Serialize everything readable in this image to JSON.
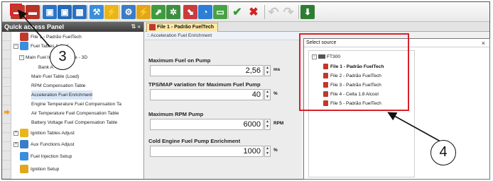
{
  "colors": {
    "accent_red": "#d8222a",
    "panel_header": "#4a4a4a",
    "tab_bg": "#ffe9a8"
  },
  "toolbar": {
    "buttons": [
      {
        "name": "file-open-red-icon",
        "color": "#c0392b",
        "glyph": "▬"
      },
      {
        "name": "file-compare-red-icon",
        "color": "#b83227",
        "glyph": "▬"
      },
      {
        "name": "blue-window-icon",
        "color": "#2b74c9",
        "glyph": "▣"
      },
      {
        "name": "blue-window-2-icon",
        "color": "#2369b8",
        "glyph": "▣"
      },
      {
        "name": "blue-tables-icon",
        "color": "#2c6fbf",
        "glyph": "▦"
      },
      {
        "name": "wrench-blue-icon",
        "color": "#3a8edc",
        "glyph": "⚒"
      },
      {
        "name": "yellow-bolt-icon",
        "color": "#e9b51b",
        "glyph": "⚡"
      },
      {
        "name": "aux-tool-icon",
        "color": "#3a7cc7",
        "glyph": "⚙"
      },
      {
        "name": "fuel-yellow-icon",
        "color": "#e2a61a",
        "glyph": "⚡"
      },
      {
        "name": "chart-green-icon",
        "color": "#3f9b3f",
        "glyph": "⬈"
      },
      {
        "name": "tools-green-icon",
        "color": "#3e8e41",
        "glyph": "✲"
      },
      {
        "name": "graph-red-icon",
        "color": "#cc3b3b",
        "glyph": "⬊"
      },
      {
        "name": "gauge-blue-icon",
        "color": "#2c7ed6",
        "glyph": "◔"
      },
      {
        "name": "monitor-green-icon",
        "color": "#48a148",
        "glyph": "▭"
      },
      {
        "name": "check-icon",
        "color": "#2f9e2f",
        "glyph": "✔"
      },
      {
        "name": "cross-icon",
        "color": "#d32222",
        "glyph": "✖"
      },
      {
        "name": "undo-icon",
        "color": "#c9c9c9",
        "glyph": "↶"
      },
      {
        "name": "redo-icon",
        "color": "#c9c9c9",
        "glyph": "↷"
      },
      {
        "name": "save-to-ecu-icon",
        "color": "#2e7d32",
        "glyph": "⬇"
      }
    ]
  },
  "quick_access": {
    "title": "Quick access Panel",
    "header_icons": "⇅ «",
    "items": [
      {
        "label": "File 1 - Padrão FuelTech",
        "indent": 0,
        "icon_color": "#c0392b",
        "expander": ""
      },
      {
        "label": "Fuel Tables Adjust",
        "indent": 0,
        "icon_color": "#3a8edc",
        "expander": "−"
      },
      {
        "label": "Main Fuel Injection Table - 3D",
        "indent": 1,
        "icon_color": "",
        "expander": "−"
      },
      {
        "label": "Bank A",
        "indent": 3,
        "icon_color": "",
        "expander": ""
      },
      {
        "label": "Main Fuel Table (Load)",
        "indent": 2,
        "icon_color": "",
        "expander": ""
      },
      {
        "label": "RPM Compensation Table",
        "indent": 2,
        "icon_color": "",
        "expander": ""
      },
      {
        "label": "Acceleration Fuel Enrichment",
        "indent": 2,
        "icon_color": "",
        "expander": "",
        "selected": true
      },
      {
        "label": "Engine Temperature Fuel Compensation Ta",
        "indent": 2,
        "icon_color": "",
        "expander": ""
      },
      {
        "label": "Air Temperature Fuel Compensation Table",
        "indent": 2,
        "icon_color": "",
        "expander": ""
      },
      {
        "label": "Battery Voltage Fuel Compensation Table",
        "indent": 2,
        "icon_color": "",
        "expander": ""
      },
      {
        "label": "Ignition Tables Adjust",
        "indent": 0,
        "icon_color": "#e9b51b",
        "expander": "+"
      },
      {
        "label": "Aux Functions Adjust",
        "indent": 0,
        "icon_color": "#3a7cc7",
        "expander": "+"
      },
      {
        "label": "Fuel Injection Setup",
        "indent": 0,
        "icon_color": "#3a8edc",
        "expander": ""
      },
      {
        "label": "Ignition Setup",
        "indent": 0,
        "icon_color": "#e2a61a",
        "expander": ""
      }
    ]
  },
  "editor": {
    "tab_label": "File 1 - Padrão FuelTech",
    "subtitle": ":: Acceleration Fuel Enrichment",
    "params": [
      {
        "label": "Maximum Fuel on Pump",
        "value": "2,56",
        "unit": "ms"
      },
      {
        "label": "TPS/MAP variation for Maximum Fuel Pump",
        "value": "40",
        "unit": "%"
      },
      {
        "label": "Maximum RPM Pump",
        "value": "6000",
        "unit": "RPM"
      },
      {
        "label": "Cold Engine Fuel Pump Enrichment",
        "value": "1000",
        "unit": "%"
      }
    ]
  },
  "select_source": {
    "title": "Select source",
    "close": "×",
    "root": "FT300",
    "expander": "−",
    "files": [
      {
        "label": "File 1 - Padrão FuelTech",
        "bold": true
      },
      {
        "label": "File 2 - Padrão FuelTech",
        "bold": false
      },
      {
        "label": "File 3 - Padrão FuelTech",
        "bold": false
      },
      {
        "label": "File 4 - Celta 1.8 Alcool",
        "bold": false
      },
      {
        "label": "File 5 - Padrão FuelTech",
        "bold": false
      }
    ]
  },
  "annotations": {
    "callout_3": "3",
    "callout_4": "4"
  }
}
